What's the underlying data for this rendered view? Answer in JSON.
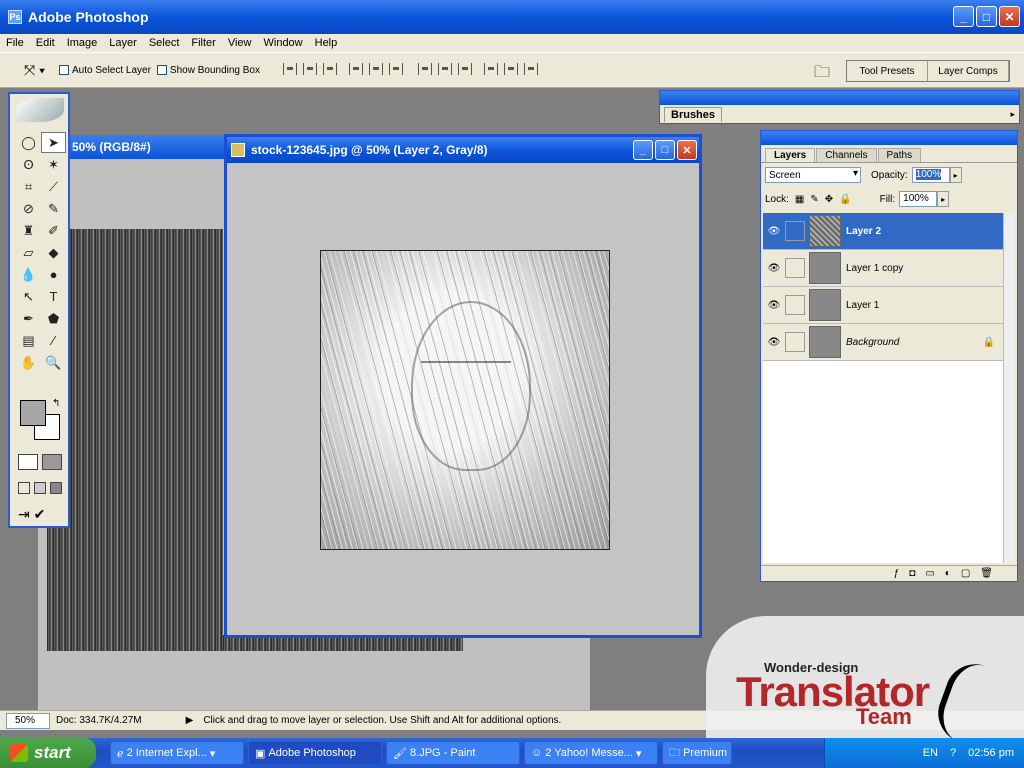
{
  "app": {
    "title": "Adobe Photoshop",
    "icon": "ps-app-icon"
  },
  "menu": [
    "File",
    "Edit",
    "Image",
    "Layer",
    "Select",
    "Filter",
    "View",
    "Window",
    "Help"
  ],
  "options": {
    "auto_select": "Auto Select Layer",
    "bounding_box": "Show Bounding Box"
  },
  "palette_well": {
    "tool_presets": "Tool Presets",
    "layer_comps": "Layer Comps"
  },
  "back_doc": {
    "title": "50% (RGB/8#)"
  },
  "main_doc": {
    "title": "stock-123645.jpg @ 50% (Layer 2, Gray/8)"
  },
  "brushes": {
    "tab": "Brushes"
  },
  "layers_panel": {
    "tabs": [
      "Layers",
      "Channels",
      "Paths"
    ],
    "blend_mode": "Screen",
    "opacity_label": "Opacity:",
    "opacity": "100%",
    "lock_label": "Lock:",
    "fill_label": "Fill:",
    "fill": "100%",
    "layers": [
      {
        "name": "Layer 2",
        "active": true
      },
      {
        "name": "Layer 1 copy",
        "active": false
      },
      {
        "name": "Layer 1",
        "active": false
      },
      {
        "name": "Background",
        "active": false,
        "locked": true
      }
    ]
  },
  "status": {
    "zoom": "50%",
    "doc": "Doc: 334.7K/4.27M",
    "hint": "Click and drag to move layer or selection.  Use Shift and Alt for additional options."
  },
  "taskbar": {
    "start": "start",
    "tasks": [
      "2 Internet Expl...",
      "Adobe Photoshop",
      "8.JPG - Paint",
      "2 Yahoo! Messe...",
      "Premium"
    ],
    "lang": "EN",
    "clock": "02:56 pm"
  },
  "watermark": {
    "line1": "Wonder-design",
    "line2": "Translator",
    "line3": "Team"
  }
}
